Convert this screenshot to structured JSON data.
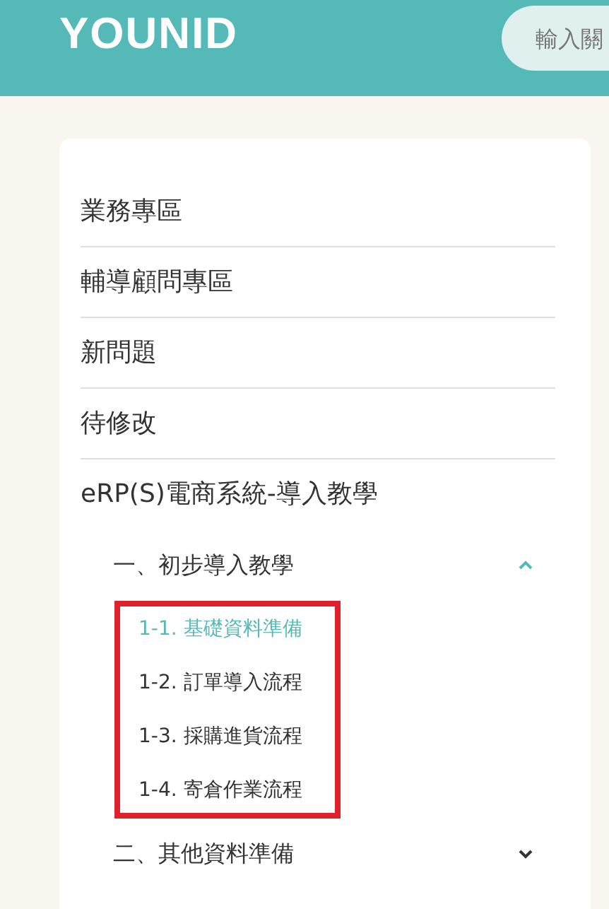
{
  "header": {
    "logo": "YOUNID",
    "search": {
      "placeholder": "輸入關"
    }
  },
  "menu": {
    "items": [
      {
        "label": "業務專區"
      },
      {
        "label": "輔導顧問專區"
      },
      {
        "label": "新問題"
      },
      {
        "label": "待修改"
      },
      {
        "label": "eRP(S)電商系統-導入教學"
      }
    ],
    "sections": [
      {
        "label": "一、初步導入教學",
        "expanded": true,
        "children": [
          {
            "label": "1-1. 基礎資料準備",
            "selected": true
          },
          {
            "label": "1-2. 訂單導入流程",
            "selected": false
          },
          {
            "label": "1-3. 採購進貨流程",
            "selected": false
          },
          {
            "label": "1-4. 寄倉作業流程",
            "selected": false
          }
        ]
      },
      {
        "label": "二、其他資料準備",
        "expanded": false
      }
    ]
  }
}
